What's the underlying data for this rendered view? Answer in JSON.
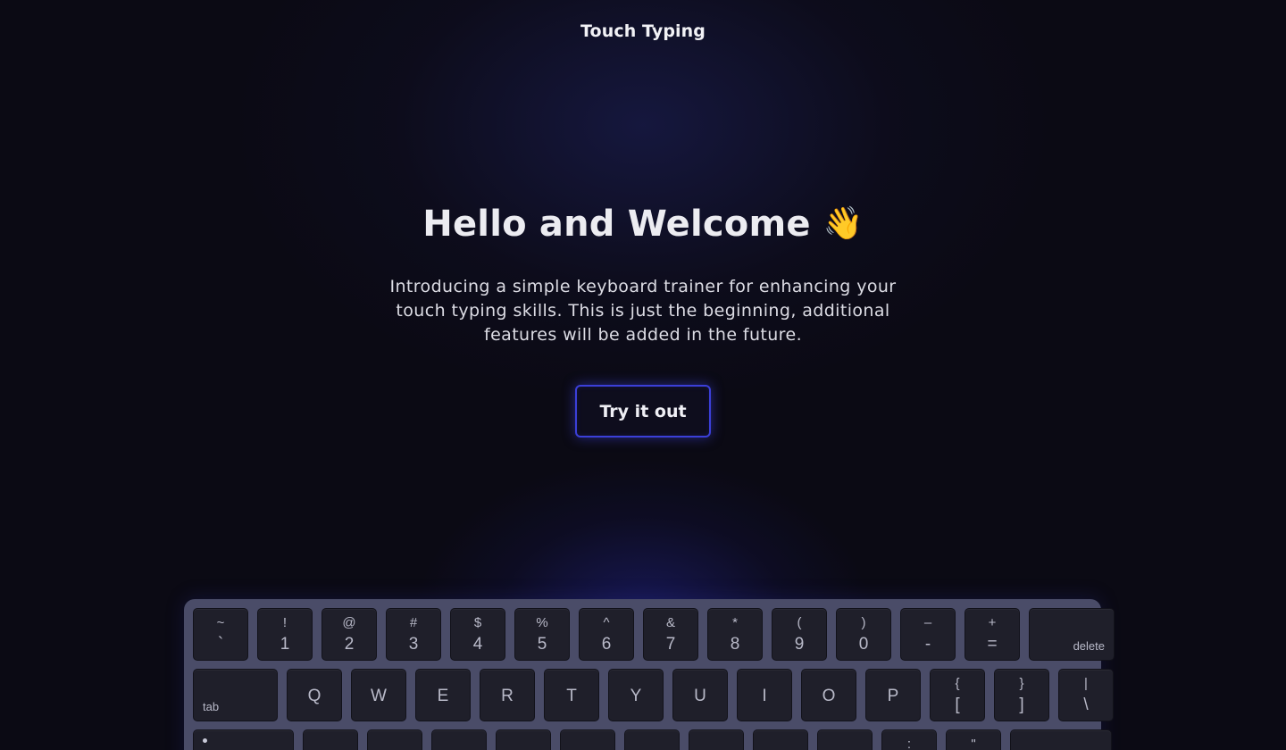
{
  "header": {
    "brand": "Touch Typing"
  },
  "hero": {
    "title": "Hello and Welcome",
    "emoji": "👋",
    "description": "Introducing a simple keyboard trainer for enhancing your touch typing skills. This is just the beginning, additional features will be added in the future.",
    "cta_label": "Try it out"
  },
  "keyboard": {
    "row1": [
      {
        "shift": "~",
        "base": "`"
      },
      {
        "shift": "!",
        "base": "1"
      },
      {
        "shift": "@",
        "base": "2"
      },
      {
        "shift": "#",
        "base": "3"
      },
      {
        "shift": "$",
        "base": "4"
      },
      {
        "shift": "%",
        "base": "5"
      },
      {
        "shift": "^",
        "base": "6"
      },
      {
        "shift": "&",
        "base": "7"
      },
      {
        "shift": "*",
        "base": "8"
      },
      {
        "shift": "(",
        "base": "9"
      },
      {
        "shift": ")",
        "base": "0"
      },
      {
        "shift": "–",
        "base": "-"
      },
      {
        "shift": "+",
        "base": "="
      }
    ],
    "delete_label": "delete",
    "tab_label": "tab",
    "row2_letters": [
      "Q",
      "W",
      "E",
      "R",
      "T",
      "Y",
      "U",
      "I",
      "O",
      "P"
    ],
    "row2_symbols": [
      {
        "shift": "{",
        "base": "["
      },
      {
        "shift": "}",
        "base": "]"
      },
      {
        "shift": "|",
        "base": "\\"
      }
    ],
    "row3_symbols": [
      {
        "shift": ":",
        "base": ";"
      },
      {
        "shift": "\"",
        "base": "'"
      }
    ]
  },
  "colors": {
    "background": "#0b0a14",
    "accent": "#3b3fd8",
    "keyboard_frame": "#4a4c68",
    "key": "#1f1f2a"
  }
}
